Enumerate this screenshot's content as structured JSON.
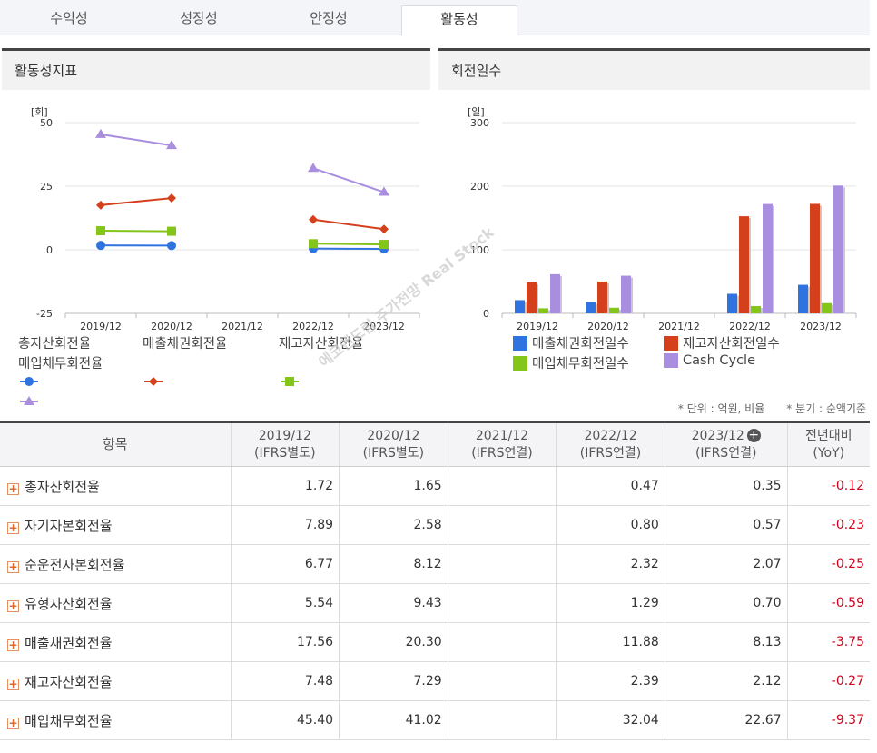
{
  "tabs": [
    {
      "label": "수익성"
    },
    {
      "label": "성장성"
    },
    {
      "label": "안정성"
    },
    {
      "label": "활동성"
    }
  ],
  "watermark": "에코앤드림 주가전망 Real Stock",
  "notes": {
    "unit": "* 단위 : 억원, 비율",
    "quarter": "* 분기 : 순액기준"
  },
  "chart_data": [
    {
      "type": "line",
      "title": "활동성지표",
      "unit_label": "[회]",
      "categories": [
        "2019/12",
        "2020/12",
        "2021/12",
        "2022/12",
        "2023/12"
      ],
      "ylim": [
        -25,
        50
      ],
      "yticks": [
        -25,
        0,
        25,
        50
      ],
      "legend_position": "bottom",
      "series": [
        {
          "name": "총자산회전율",
          "values": [
            1.72,
            1.65,
            null,
            0.47,
            0.35
          ],
          "color": "#2f73e0",
          "marker": "circle"
        },
        {
          "name": "매출채권회전율",
          "values": [
            17.56,
            20.3,
            null,
            11.88,
            8.13
          ],
          "color": "#d4401b",
          "marker": "diamond"
        },
        {
          "name": "재고자산회전율",
          "values": [
            7.48,
            7.29,
            null,
            2.39,
            2.12
          ],
          "color": "#84c51a",
          "marker": "square"
        },
        {
          "name": "매입채무회전율",
          "values": [
            45.4,
            41.02,
            null,
            32.04,
            22.67
          ],
          "color": "#a98ee0",
          "marker": "triangle"
        }
      ]
    },
    {
      "type": "bar",
      "title": "회전일수",
      "unit_label": "[일]",
      "categories": [
        "2019/12",
        "2020/12",
        "2021/12",
        "2022/12",
        "2023/12"
      ],
      "ylim": [
        0,
        300
      ],
      "yticks": [
        0,
        100,
        200,
        300
      ],
      "legend_position": "bottom",
      "series": [
        {
          "name": "매출채권회전일수",
          "values": [
            20.8,
            18.0,
            null,
            30.7,
            44.9
          ],
          "color": "#2f73e0"
        },
        {
          "name": "재고자산회전일수",
          "values": [
            48.8,
            50.1,
            null,
            152.7,
            172.2
          ],
          "color": "#d4401b"
        },
        {
          "name": "매입채무회전일수",
          "values": [
            8.0,
            8.9,
            null,
            11.4,
            16.1
          ],
          "color": "#84c51a"
        },
        {
          "name": "Cash Cycle",
          "values": [
            61.6,
            59.2,
            null,
            172.0,
            201.0
          ],
          "color": "#a98ee0"
        }
      ]
    }
  ],
  "table": {
    "headers": [
      {
        "line1": "항목",
        "line2": ""
      },
      {
        "line1": "2019/12",
        "line2": "(IFRS별도)"
      },
      {
        "line1": "2020/12",
        "line2": "(IFRS별도)"
      },
      {
        "line1": "2021/12",
        "line2": "(IFRS연결)"
      },
      {
        "line1": "2022/12",
        "line2": "(IFRS연결)"
      },
      {
        "line1": "2023/12",
        "line2": "(IFRS연결)"
      },
      {
        "line1": "전년대비",
        "line2": "(YoY)"
      }
    ],
    "rows": [
      {
        "label": "총자산회전율",
        "v2019": "1.72",
        "v2020": "1.65",
        "v2021": "",
        "v2022": "0.47",
        "v2023": "0.35",
        "yoy": "-0.12"
      },
      {
        "label": "자기자본회전율",
        "v2019": "7.89",
        "v2020": "2.58",
        "v2021": "",
        "v2022": "0.80",
        "v2023": "0.57",
        "yoy": "-0.23"
      },
      {
        "label": "순운전자본회전율",
        "v2019": "6.77",
        "v2020": "8.12",
        "v2021": "",
        "v2022": "2.32",
        "v2023": "2.07",
        "yoy": "-0.25"
      },
      {
        "label": "유형자산회전율",
        "v2019": "5.54",
        "v2020": "9.43",
        "v2021": "",
        "v2022": "1.29",
        "v2023": "0.70",
        "yoy": "-0.59"
      },
      {
        "label": "매출채권회전율",
        "v2019": "17.56",
        "v2020": "20.30",
        "v2021": "",
        "v2022": "11.88",
        "v2023": "8.13",
        "yoy": "-3.75"
      },
      {
        "label": "재고자산회전율",
        "v2019": "7.48",
        "v2020": "7.29",
        "v2021": "",
        "v2022": "2.39",
        "v2023": "2.12",
        "yoy": "-0.27"
      },
      {
        "label": "매입채무회전율",
        "v2019": "45.40",
        "v2020": "41.02",
        "v2021": "",
        "v2022": "32.04",
        "v2023": "22.67",
        "yoy": "-9.37"
      }
    ]
  }
}
